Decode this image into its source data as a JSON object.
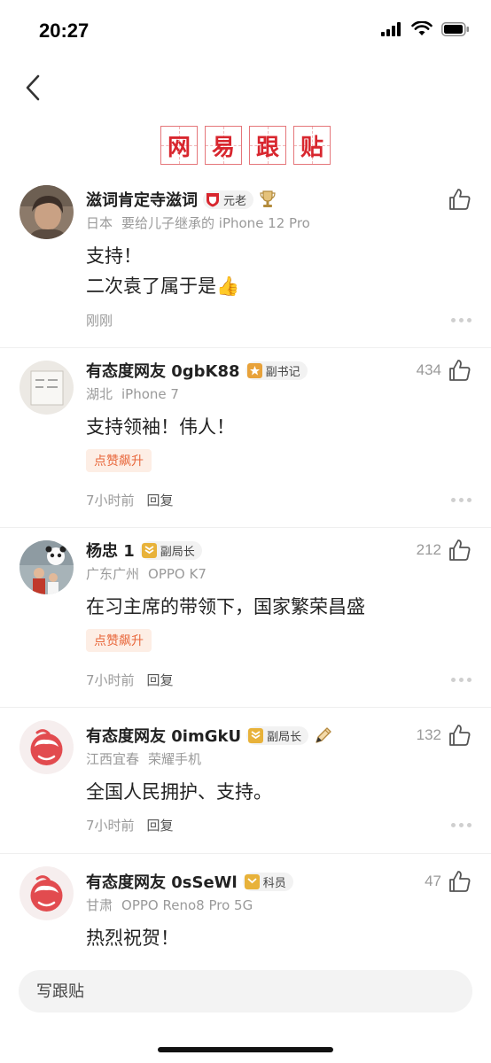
{
  "status_bar": {
    "time": "20:27"
  },
  "brand": {
    "chars": [
      "网",
      "易",
      "跟",
      "贴"
    ]
  },
  "comments": [
    {
      "username": "滋词肯定寺滋词",
      "badge": "元老",
      "badge_color": "#d8262e",
      "location": "日本",
      "device": "要给儿子继承的 iPhone 12 Pro",
      "content_lines": [
        "支持！",
        "二次袁了属于是👍"
      ],
      "likes": "",
      "hot_tag": "",
      "time": "刚刚",
      "reply": ""
    },
    {
      "username": "有态度网友 0gbK88",
      "badge": "副书记",
      "badge_color": "#e8a23a",
      "location": "湖北",
      "device": "iPhone 7",
      "content_lines": [
        "支持领袖！伟人！"
      ],
      "likes": "434",
      "hot_tag": "点赞飙升",
      "time": "7小时前",
      "reply": "回复"
    },
    {
      "username": "杨忠 1",
      "badge": "副局长",
      "badge_color": "#e8b23a",
      "location": "广东广州",
      "device": "OPPO K7",
      "content_lines": [
        "在习主席的带领下，国家繁荣昌盛"
      ],
      "likes": "212",
      "hot_tag": "点赞飙升",
      "time": "7小时前",
      "reply": "回复"
    },
    {
      "username": "有态度网友 0imGkU",
      "badge": "副局长",
      "badge_color": "#e8b23a",
      "location": "江西宜春",
      "device": "荣耀手机",
      "content_lines": [
        "全国人民拥护、支持。"
      ],
      "likes": "132",
      "hot_tag": "",
      "time": "7小时前",
      "reply": "回复"
    },
    {
      "username": "有态度网友 0sSeWl",
      "badge": "科员",
      "badge_color": "#e8b23a",
      "location": "甘肃",
      "device": "OPPO Reno8 Pro 5G",
      "content_lines": [
        "热烈祝贺！"
      ],
      "likes": "47",
      "hot_tag": "",
      "time": "",
      "reply": ""
    }
  ],
  "reply_bar": {
    "placeholder": "写跟贴"
  },
  "colors": {
    "accent": "#d8262e",
    "hot_tag": "#e8663a"
  }
}
